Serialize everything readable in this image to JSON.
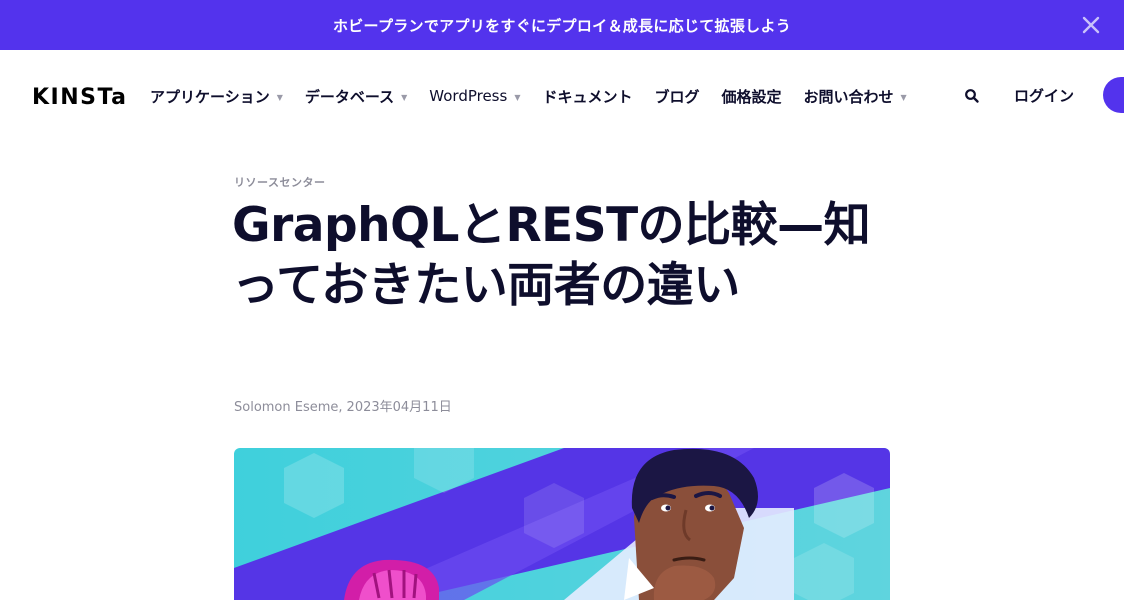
{
  "promo": {
    "text": "ホビープランでアプリをすぐにデプロイ＆成長に応じて拡張しよう",
    "close_icon": "close-icon",
    "background": "#5333ed"
  },
  "header": {
    "logo": "KINSTa",
    "nav": [
      {
        "label": "アプリケーション",
        "has_dropdown": true
      },
      {
        "label": "データベース",
        "has_dropdown": true
      },
      {
        "label": "WordPress",
        "has_dropdown": true
      },
      {
        "label": "ドキュメント",
        "has_dropdown": false
      },
      {
        "label": "ブログ",
        "has_dropdown": false
      },
      {
        "label": "価格設定",
        "has_dropdown": false
      },
      {
        "label": "お問い合わせ",
        "has_dropdown": true
      }
    ],
    "search_icon": "search-icon",
    "login_label": "ログイン",
    "accent": "#5333ed"
  },
  "article": {
    "category": "リソースセンター",
    "title": "GraphQLとRESTの比較—知っておきたい両者の違い",
    "author": "Solomon Eseme",
    "date": "2023年04月11日"
  }
}
